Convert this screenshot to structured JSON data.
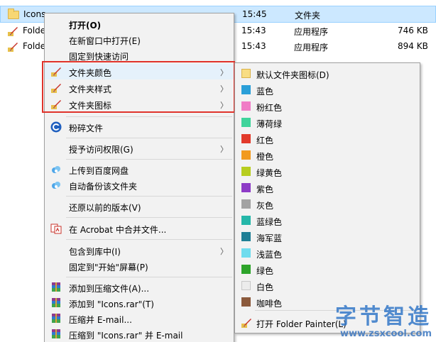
{
  "explorer": {
    "rows": [
      {
        "name": "Icons",
        "time": "15:45",
        "type": "文件夹",
        "size": ""
      },
      {
        "name": "Folde",
        "time": "15:43",
        "type": "应用程序",
        "size": "746 KB"
      },
      {
        "name": "Folde",
        "time": "15:43",
        "type": "应用程序",
        "size": "894 KB"
      }
    ]
  },
  "context_menu": {
    "open": "打开(O)",
    "open_new_window": "在新窗口中打开(E)",
    "pin_quick_access": "固定到快速访问",
    "folder_color": "文件夹颜色",
    "folder_style": "文件夹样式",
    "folder_icon": "文件夹图标",
    "shred": "粉碎文件",
    "grant_access": "授予访问权限(G)",
    "upload_baidu": "上传到百度网盘",
    "auto_backup": "自动备份该文件夹",
    "restore_previous": "还原以前的版本(V)",
    "acrobat_merge": "在 Acrobat 中合并文件...",
    "include_library": "包含到库中(I)",
    "pin_start": "固定到\"开始\"屏幕(P)",
    "add_archive": "添加到压缩文件(A)...",
    "add_icons_rar": "添加到 \"Icons.rar\"(T)",
    "compress_email": "压缩并 E-mail...",
    "compress_icons_email": "压缩到 \"Icons.rar\" 并 E-mail",
    "arrow": "〉"
  },
  "color_menu": {
    "items": [
      {
        "label": "默认文件夹图标(D)",
        "color": "#f8dd83"
      },
      {
        "label": "蓝色",
        "color": "#2a9fd8"
      },
      {
        "label": "粉红色",
        "color": "#f07cc6"
      },
      {
        "label": "薄荷绿",
        "color": "#3fd49b"
      },
      {
        "label": "红色",
        "color": "#e23a2b"
      },
      {
        "label": "橙色",
        "color": "#f29a1e"
      },
      {
        "label": "绿黄色",
        "color": "#b7cd1f"
      },
      {
        "label": "紫色",
        "color": "#8d3bc6"
      },
      {
        "label": "灰色",
        "color": "#a2a2a2"
      },
      {
        "label": "蓝绿色",
        "color": "#25b7a9"
      },
      {
        "label": "海军蓝",
        "color": "#1f7f95"
      },
      {
        "label": "浅蓝色",
        "color": "#6fdcee"
      },
      {
        "label": "绿色",
        "color": "#2ea42b"
      },
      {
        "label": "白色",
        "color": "#ececec"
      },
      {
        "label": "咖啡色",
        "color": "#8b5a3c"
      }
    ],
    "open_painter": "打开 Folder Painter(L)"
  },
  "watermark": {
    "title": "字节智造",
    "url": "www.zsxcool.com"
  },
  "colors": {
    "selection": "#cce8ff",
    "highlight_box": "#e0332b",
    "menu_bg": "#f2f2f2"
  }
}
